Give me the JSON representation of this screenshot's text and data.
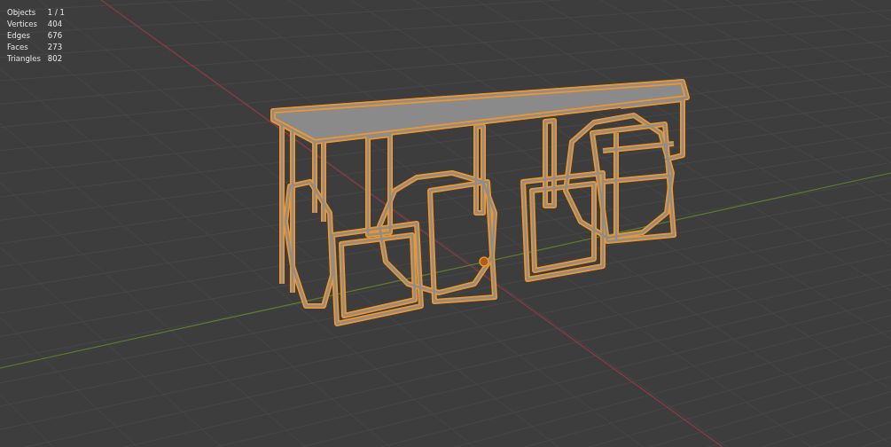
{
  "stats": [
    {
      "label": "Objects",
      "value": "1 / 1"
    },
    {
      "label": "Vertices",
      "value": "404"
    },
    {
      "label": "Edges",
      "value": "676"
    },
    {
      "label": "Faces",
      "value": "273"
    },
    {
      "label": "Triangles",
      "value": "802"
    }
  ]
}
